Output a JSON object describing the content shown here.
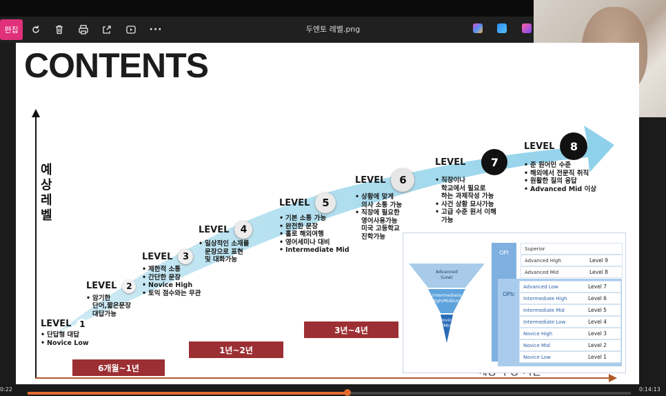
{
  "toolbar": {
    "edit_label": "편집",
    "file_title": "두엔토 레벨.png",
    "more_label": "···"
  },
  "slide": {
    "title": "CONTENTS",
    "y_axis_label": [
      "예",
      "상",
      "레",
      "벨"
    ],
    "x_axis_label": "예상 수강 기간",
    "periods": [
      {
        "label": "6개월~1년"
      },
      {
        "label": "1년~2년"
      },
      {
        "label": "3년~4년"
      }
    ],
    "levels": [
      {
        "label": "LEVEL",
        "num": "1",
        "items": [
          "단답형 대답",
          "Novice Low"
        ]
      },
      {
        "label": "LEVEL",
        "num": "2",
        "items": [
          "암기한\n단어,짧은문장\n대답가능"
        ]
      },
      {
        "label": "LEVEL",
        "num": "3",
        "items": [
          "제한적 소통",
          "간단한 문장",
          "Novice High",
          "토익 점수와는 무관"
        ]
      },
      {
        "label": "LEVEL",
        "num": "4",
        "items": [
          "일상적인 소재를\n문장으로 표현\n및 대화가능"
        ]
      },
      {
        "label": "LEVEL",
        "num": "5",
        "items": [
          "기본 소통 가능",
          "완전한 문장",
          "홀로 해외여행",
          "영어세미나 대비",
          "Intermediate Mid"
        ]
      },
      {
        "label": "LEVEL",
        "num": "6",
        "items": [
          "상황에 맞게\n의사 소통 가능",
          "직장에 필요한\n영어사용가능\n미국 고등학교\n진학가능"
        ]
      },
      {
        "label": "LEVEL",
        "num": "7",
        "items": [
          "직장이나\n학교에서 필요로\n하는 과제작성 가능",
          "사건 상황 묘사가능",
          "고급 수준 원서 이해\n가능"
        ]
      },
      {
        "label": "LEVEL",
        "num": "8",
        "items": [
          "준 원어민 수준",
          "해외에서 전문직 취직",
          "원활한 질의 응답",
          "Advanced Mid 이상"
        ]
      }
    ],
    "inset": {
      "funnel": [
        "Advanced\n(Low)",
        "Intermediate\n(High/Mid/Low)",
        "Novice\n(High/Mid/Low)"
      ],
      "opi_label": "OPI",
      "opic_label": "OPIc",
      "rows": [
        {
          "name": "Superior",
          "level": ""
        },
        {
          "name": "Advanced High",
          "level": "Level 9"
        },
        {
          "name": "Advanced Mid",
          "level": "Level 8"
        },
        {
          "name": "Advanced Low",
          "level": "Level 7"
        },
        {
          "name": "Intermediate High",
          "level": "Level 6"
        },
        {
          "name": "Intermediate Mid",
          "level": "Level 5"
        },
        {
          "name": "Intermediate Low",
          "level": "Level 4"
        },
        {
          "name": "Novice High",
          "level": "Level 3"
        },
        {
          "name": "Novice Mid",
          "level": "Level 2"
        },
        {
          "name": "Novice Low",
          "level": "Level 1"
        }
      ]
    }
  },
  "player": {
    "current_time": "0:22",
    "total_time": "0:14:13",
    "progress": 0.53
  },
  "colors": {
    "accent": "#e0307a",
    "period_bar": "#9c2f33",
    "timeline_arrow": "#b35a2a",
    "wave": "#9ad2e6",
    "progress": "#e36a2f"
  }
}
